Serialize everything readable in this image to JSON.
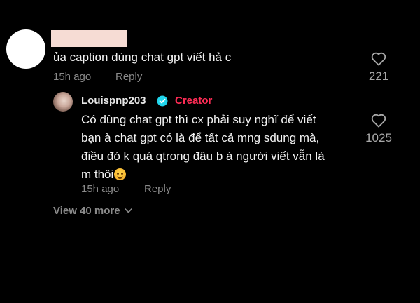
{
  "comment": {
    "text": "ủa caption dùng chat gpt viết hả c",
    "time": "15h ago",
    "reply_label": "Reply",
    "likes": "221"
  },
  "reply": {
    "username": "Louispnp203",
    "badge": "Creator",
    "lines": [
      "Có dùng chat gpt thì cx phải suy nghĩ để viết",
      "bạn à chat gpt có là để tất cả mng sdung mà,",
      "điều đó k quá qtrong đâu b à người viết vẫn là",
      "m thôi"
    ],
    "emoji": "smiling-face-emoji",
    "time": "15h ago",
    "reply_label": "Reply",
    "likes": "1025"
  },
  "view_more": {
    "label": "View 40 more"
  },
  "colors": {
    "background": "#000000",
    "creator": "#fe2c55",
    "verified": "#20d5ec",
    "secondary_text": "#8a8a8a"
  },
  "icons": {
    "like": "heart-outline-icon",
    "verified": "verified-badge-icon",
    "expand": "chevron-down-icon"
  }
}
